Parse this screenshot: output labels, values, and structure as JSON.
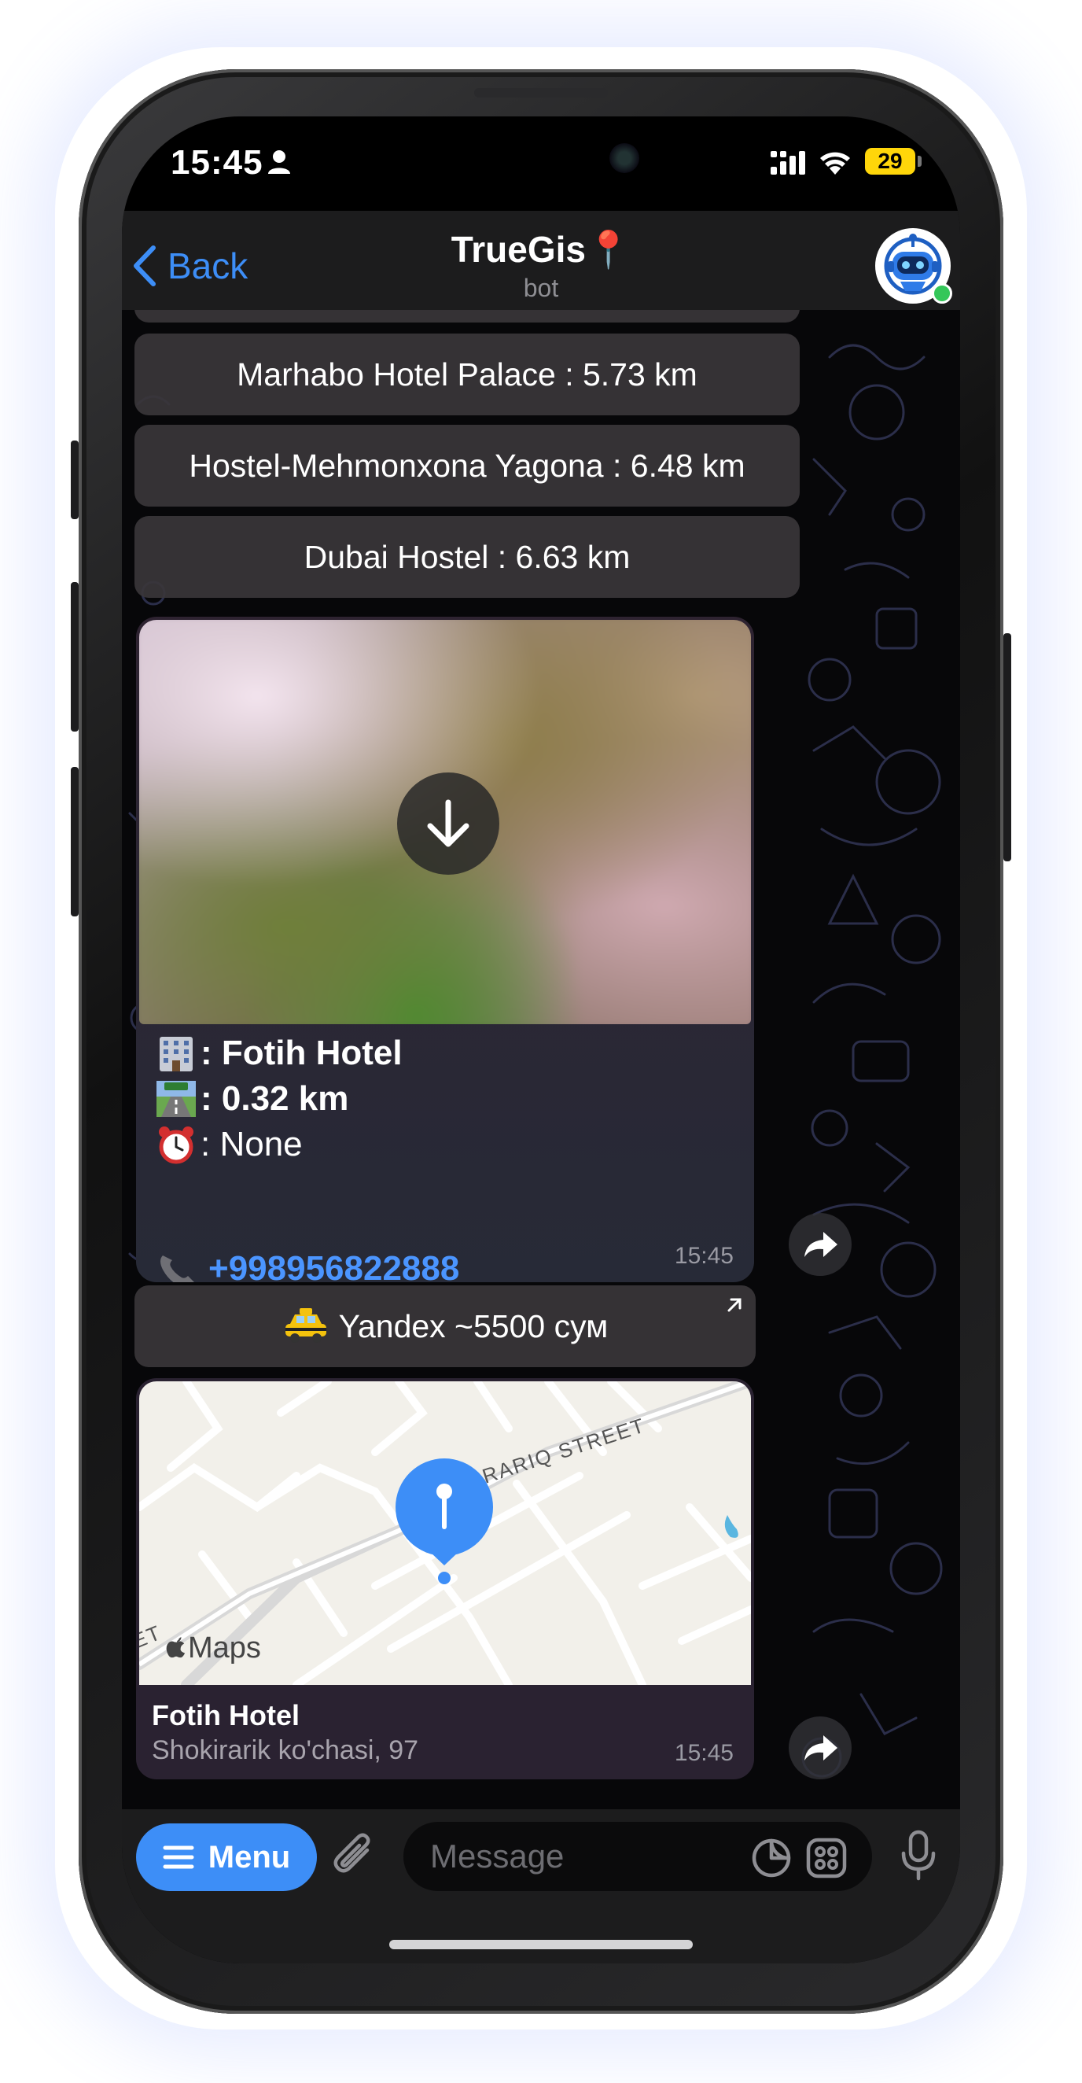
{
  "status_bar": {
    "time": "15:45",
    "battery": "29",
    "icons": [
      "person-icon",
      "signal-icon",
      "wifi-icon",
      "battery-icon"
    ]
  },
  "header": {
    "back_label": "Back",
    "title": "TrueGis📍",
    "subtitle": "bot",
    "avatar_icon": "robot-avatar-icon"
  },
  "keyboard_buttons": [
    "Marhabo Hotel Palace : 5.73 km",
    "Hostel-Mehmonxona Yagona : 6.48 km",
    "Dubai Hostel : 6.63 km"
  ],
  "hotel_message": {
    "photo_action_icon": "download-arrow-icon",
    "name": ": Fotih Hotel",
    "distance": ": 0.32 km",
    "hours": ": None",
    "phone": "+998956822888",
    "time": "15:45"
  },
  "taxi_button": {
    "label": "Yandex ~5500 сум",
    "icon": "taxi-icon"
  },
  "location_message": {
    "street_label": "RARIQ STREET",
    "street_label_2": "ET",
    "maps_brand": "Maps",
    "title": "Fotih Hotel",
    "address": "Shokirarik ko'chasi, 97",
    "time": "15:45"
  },
  "input_bar": {
    "menu_label": "Menu",
    "placeholder": "Message",
    "icons": [
      "attach-icon",
      "sticker-icon",
      "apps-icon",
      "mic-icon"
    ]
  },
  "colors": {
    "accent": "#3d8ef7",
    "link": "#4b95ff",
    "chat_background": "#070709",
    "bar_background": "#1c1c1d",
    "pin": "#3d8ef7"
  }
}
